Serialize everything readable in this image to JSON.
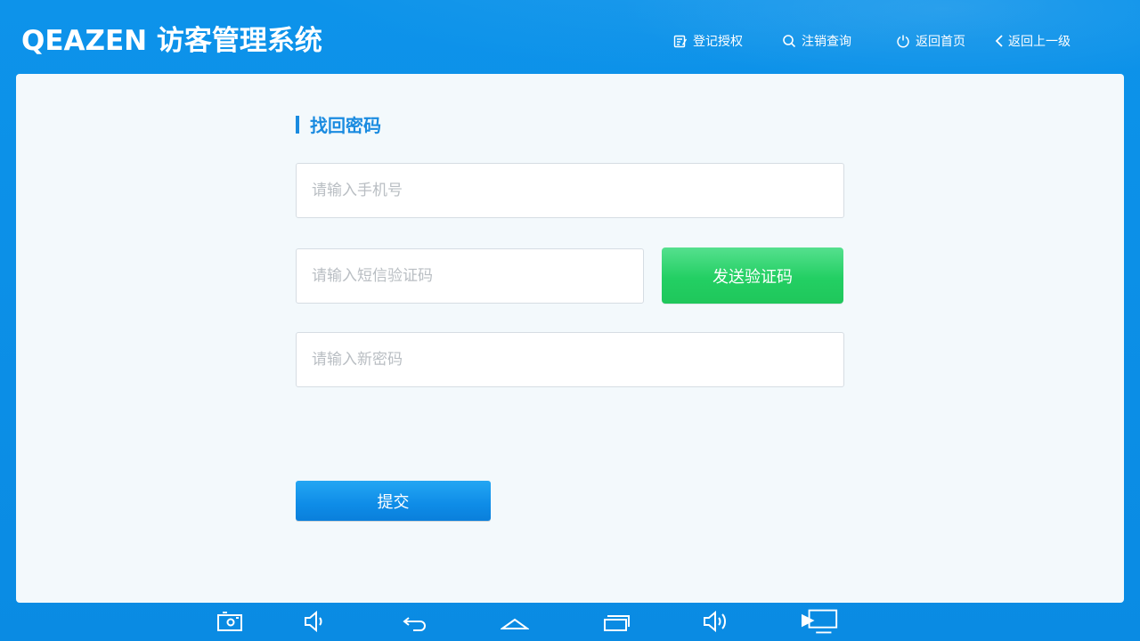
{
  "header": {
    "title": "QEAZEN 访客管理系统",
    "nav": {
      "register": "登记授权",
      "query": "注销查询",
      "home": "返回首页",
      "back": "返回上一级"
    }
  },
  "form": {
    "section_title": "找回密码",
    "phone_placeholder": "请输入手机号",
    "sms_placeholder": "请输入短信验证码",
    "password_placeholder": "请输入新密码",
    "send_code_label": "发送验证码",
    "submit_label": "提交"
  },
  "system_bar": {
    "icons": [
      "screenshot-icon",
      "volume-down-icon",
      "back-icon",
      "home-icon",
      "recent-apps-icon",
      "volume-up-icon",
      "screen-cast-icon"
    ]
  },
  "colors": {
    "background": "#0b8fe6",
    "card": "#f3f9fc",
    "accent": "#1a8be0",
    "send_button": "#23cf63",
    "submit_button": "#0e8ce7"
  }
}
